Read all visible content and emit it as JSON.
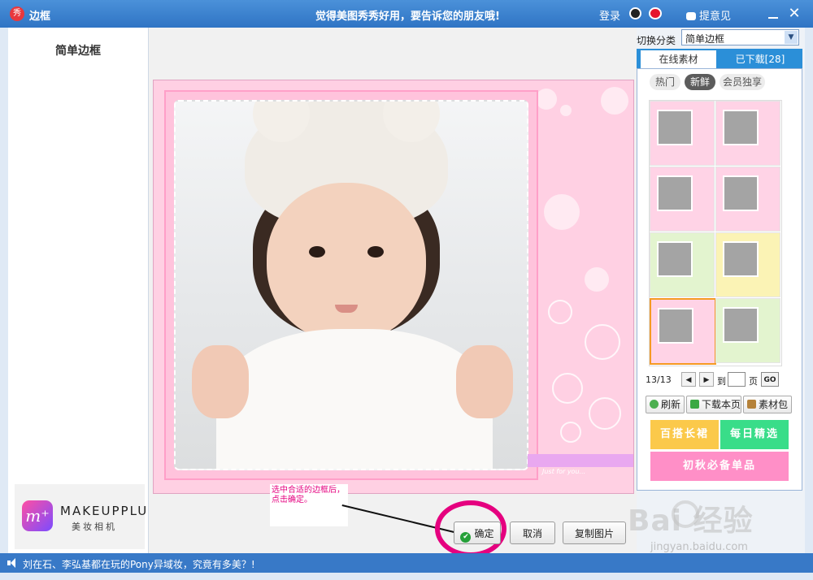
{
  "titlebar": {
    "app_icon_text": "秀",
    "title": "边框",
    "slogan": "觉得美图秀秀好用，要告诉您的朋友哦!",
    "login": "登录",
    "feedback": "提意见",
    "close_glyph": "✕"
  },
  "left_panel": {
    "title": "简单边框",
    "promo": {
      "logo_glyph": "m⁺",
      "brand": "MAKEUPPLUS",
      "sub": "美妆相机"
    }
  },
  "annotation": {
    "text": "选中合适的边框后，点击确定。"
  },
  "frame_caption": "Just for you...",
  "buttons": {
    "ok": "确定",
    "ok_icon": "✔",
    "cancel": "取消",
    "copy": "复制图片"
  },
  "right_panel": {
    "category_label": "切换分类",
    "category_value": "简单边框",
    "tabs": {
      "online": "在线素材",
      "downloaded": "已下载[28]"
    },
    "subtabs": {
      "hot": "热门",
      "new": "新鲜",
      "vip": "会员独享"
    },
    "pager": {
      "page": "13/13",
      "to": "到",
      "unit": "页",
      "go": "GO",
      "prev_glyph": "◀",
      "next_glyph": "▶"
    },
    "actions": {
      "refresh": "刷新",
      "download_page": "下载本页",
      "pack": "素材包"
    },
    "banners": {
      "b1": "百搭长裙",
      "b2": "每日精选",
      "b3": "初秋必备单品"
    }
  },
  "statusbar": {
    "text": "刘在石、李弘基都在玩的Pony异域妆，究竟有多美？!"
  },
  "watermark": {
    "main": "Bai 经验",
    "sub": "jingyan.baidu.com"
  },
  "colors": {
    "title_bar": "#2f74c4",
    "accent_pink": "#e5007f",
    "frame_pink": "#ffd0e3",
    "status_bar": "#3879c7"
  }
}
